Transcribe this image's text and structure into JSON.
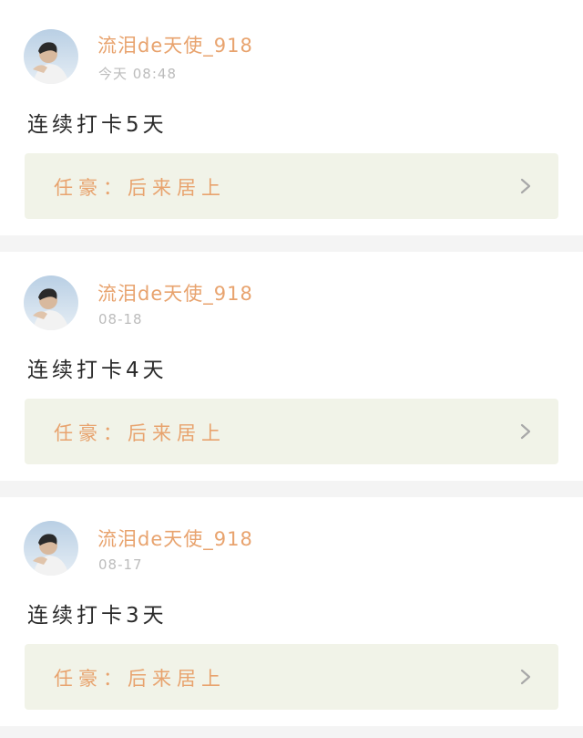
{
  "posts": [
    {
      "username": "流泪de天使_918",
      "time": "今天 08:48",
      "text": "连续打卡5天",
      "song": "任豪：后来居上"
    },
    {
      "username": "流泪de天使_918",
      "time": "08-18",
      "text": "连续打卡4天",
      "song": "任豪：后来居上"
    },
    {
      "username": "流泪de天使_918",
      "time": "08-17",
      "text": "连续打卡3天",
      "song": "任豪：后来居上"
    }
  ],
  "icons": {
    "avatar": "user-avatar",
    "chevron": "chevron-right-icon"
  },
  "colors": {
    "username": "#e8a36e",
    "song_box_bg": "#f1f3e8",
    "timestamp": "#bcbcbc",
    "feed_bg": "#f4f4f4"
  }
}
